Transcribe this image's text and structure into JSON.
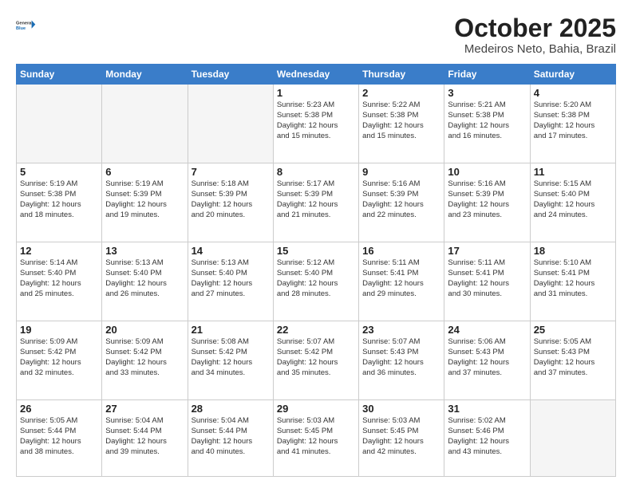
{
  "header": {
    "logo_line1": "General",
    "logo_line2": "Blue",
    "title": "October 2025",
    "subtitle": "Medeiros Neto, Bahia, Brazil"
  },
  "calendar": {
    "weekdays": [
      "Sunday",
      "Monday",
      "Tuesday",
      "Wednesday",
      "Thursday",
      "Friday",
      "Saturday"
    ],
    "weeks": [
      [
        {
          "day": "",
          "info": ""
        },
        {
          "day": "",
          "info": ""
        },
        {
          "day": "",
          "info": ""
        },
        {
          "day": "1",
          "info": "Sunrise: 5:23 AM\nSunset: 5:38 PM\nDaylight: 12 hours\nand 15 minutes."
        },
        {
          "day": "2",
          "info": "Sunrise: 5:22 AM\nSunset: 5:38 PM\nDaylight: 12 hours\nand 15 minutes."
        },
        {
          "day": "3",
          "info": "Sunrise: 5:21 AM\nSunset: 5:38 PM\nDaylight: 12 hours\nand 16 minutes."
        },
        {
          "day": "4",
          "info": "Sunrise: 5:20 AM\nSunset: 5:38 PM\nDaylight: 12 hours\nand 17 minutes."
        }
      ],
      [
        {
          "day": "5",
          "info": "Sunrise: 5:19 AM\nSunset: 5:38 PM\nDaylight: 12 hours\nand 18 minutes."
        },
        {
          "day": "6",
          "info": "Sunrise: 5:19 AM\nSunset: 5:39 PM\nDaylight: 12 hours\nand 19 minutes."
        },
        {
          "day": "7",
          "info": "Sunrise: 5:18 AM\nSunset: 5:39 PM\nDaylight: 12 hours\nand 20 minutes."
        },
        {
          "day": "8",
          "info": "Sunrise: 5:17 AM\nSunset: 5:39 PM\nDaylight: 12 hours\nand 21 minutes."
        },
        {
          "day": "9",
          "info": "Sunrise: 5:16 AM\nSunset: 5:39 PM\nDaylight: 12 hours\nand 22 minutes."
        },
        {
          "day": "10",
          "info": "Sunrise: 5:16 AM\nSunset: 5:39 PM\nDaylight: 12 hours\nand 23 minutes."
        },
        {
          "day": "11",
          "info": "Sunrise: 5:15 AM\nSunset: 5:40 PM\nDaylight: 12 hours\nand 24 minutes."
        }
      ],
      [
        {
          "day": "12",
          "info": "Sunrise: 5:14 AM\nSunset: 5:40 PM\nDaylight: 12 hours\nand 25 minutes."
        },
        {
          "day": "13",
          "info": "Sunrise: 5:13 AM\nSunset: 5:40 PM\nDaylight: 12 hours\nand 26 minutes."
        },
        {
          "day": "14",
          "info": "Sunrise: 5:13 AM\nSunset: 5:40 PM\nDaylight: 12 hours\nand 27 minutes."
        },
        {
          "day": "15",
          "info": "Sunrise: 5:12 AM\nSunset: 5:40 PM\nDaylight: 12 hours\nand 28 minutes."
        },
        {
          "day": "16",
          "info": "Sunrise: 5:11 AM\nSunset: 5:41 PM\nDaylight: 12 hours\nand 29 minutes."
        },
        {
          "day": "17",
          "info": "Sunrise: 5:11 AM\nSunset: 5:41 PM\nDaylight: 12 hours\nand 30 minutes."
        },
        {
          "day": "18",
          "info": "Sunrise: 5:10 AM\nSunset: 5:41 PM\nDaylight: 12 hours\nand 31 minutes."
        }
      ],
      [
        {
          "day": "19",
          "info": "Sunrise: 5:09 AM\nSunset: 5:42 PM\nDaylight: 12 hours\nand 32 minutes."
        },
        {
          "day": "20",
          "info": "Sunrise: 5:09 AM\nSunset: 5:42 PM\nDaylight: 12 hours\nand 33 minutes."
        },
        {
          "day": "21",
          "info": "Sunrise: 5:08 AM\nSunset: 5:42 PM\nDaylight: 12 hours\nand 34 minutes."
        },
        {
          "day": "22",
          "info": "Sunrise: 5:07 AM\nSunset: 5:42 PM\nDaylight: 12 hours\nand 35 minutes."
        },
        {
          "day": "23",
          "info": "Sunrise: 5:07 AM\nSunset: 5:43 PM\nDaylight: 12 hours\nand 36 minutes."
        },
        {
          "day": "24",
          "info": "Sunrise: 5:06 AM\nSunset: 5:43 PM\nDaylight: 12 hours\nand 37 minutes."
        },
        {
          "day": "25",
          "info": "Sunrise: 5:05 AM\nSunset: 5:43 PM\nDaylight: 12 hours\nand 37 minutes."
        }
      ],
      [
        {
          "day": "26",
          "info": "Sunrise: 5:05 AM\nSunset: 5:44 PM\nDaylight: 12 hours\nand 38 minutes."
        },
        {
          "day": "27",
          "info": "Sunrise: 5:04 AM\nSunset: 5:44 PM\nDaylight: 12 hours\nand 39 minutes."
        },
        {
          "day": "28",
          "info": "Sunrise: 5:04 AM\nSunset: 5:44 PM\nDaylight: 12 hours\nand 40 minutes."
        },
        {
          "day": "29",
          "info": "Sunrise: 5:03 AM\nSunset: 5:45 PM\nDaylight: 12 hours\nand 41 minutes."
        },
        {
          "day": "30",
          "info": "Sunrise: 5:03 AM\nSunset: 5:45 PM\nDaylight: 12 hours\nand 42 minutes."
        },
        {
          "day": "31",
          "info": "Sunrise: 5:02 AM\nSunset: 5:46 PM\nDaylight: 12 hours\nand 43 minutes."
        },
        {
          "day": "",
          "info": ""
        }
      ]
    ]
  }
}
